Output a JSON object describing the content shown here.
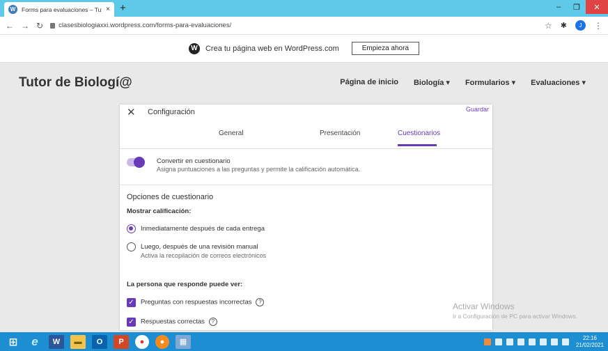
{
  "browser": {
    "tab_title": "Forms para evaluaciones – Tutor",
    "tab_close": "×",
    "new_tab": "+",
    "url": "clasesbiologiaxxi.wordpress.com/forms-para-evaluaciones/",
    "profile_initial": "J"
  },
  "wp_banner": {
    "text": "Crea tu página web en WordPress.com",
    "button": "Empieza ahora"
  },
  "site": {
    "title": "Tutor de Biologí@",
    "nav": [
      "Página de inicio",
      "Biología ▾",
      "Formularios ▾",
      "Evaluaciones ▾"
    ]
  },
  "dialog": {
    "title": "Configuración",
    "save": "Guardar",
    "tabs": [
      "General",
      "Presentación",
      "Cuestionarios"
    ],
    "active_tab": "Cuestionarios",
    "toggle": {
      "label": "Convertir en cuestionario",
      "description": "Asigna puntuaciones a las preguntas y permite la calificación automática.",
      "on": true
    },
    "options_title": "Opciones de cuestionario",
    "show_grade_heading": "Mostrar calificación:",
    "radios": [
      {
        "label": "Inmediatamente después de cada entrega",
        "checked": true
      },
      {
        "label": "Luego, después de una revisión manual",
        "description": "Activa la recopilación de correos electrónicos",
        "checked": false
      }
    ],
    "respondent_heading": "La persona que responde puede ver:",
    "checkboxes": [
      {
        "label": "Preguntas con respuestas incorrectas",
        "checked": true
      },
      {
        "label": "Respuestas correctas",
        "checked": true
      }
    ]
  },
  "watermark": {
    "line1": "Activar Windows",
    "line2": "Ir a Configuración de PC para activar Windows."
  },
  "taskbar": {
    "word_label": "W",
    "outlook_label": "O",
    "ppt_label": "P",
    "clock_time": "22:16",
    "clock_date": "21/02/2021"
  }
}
